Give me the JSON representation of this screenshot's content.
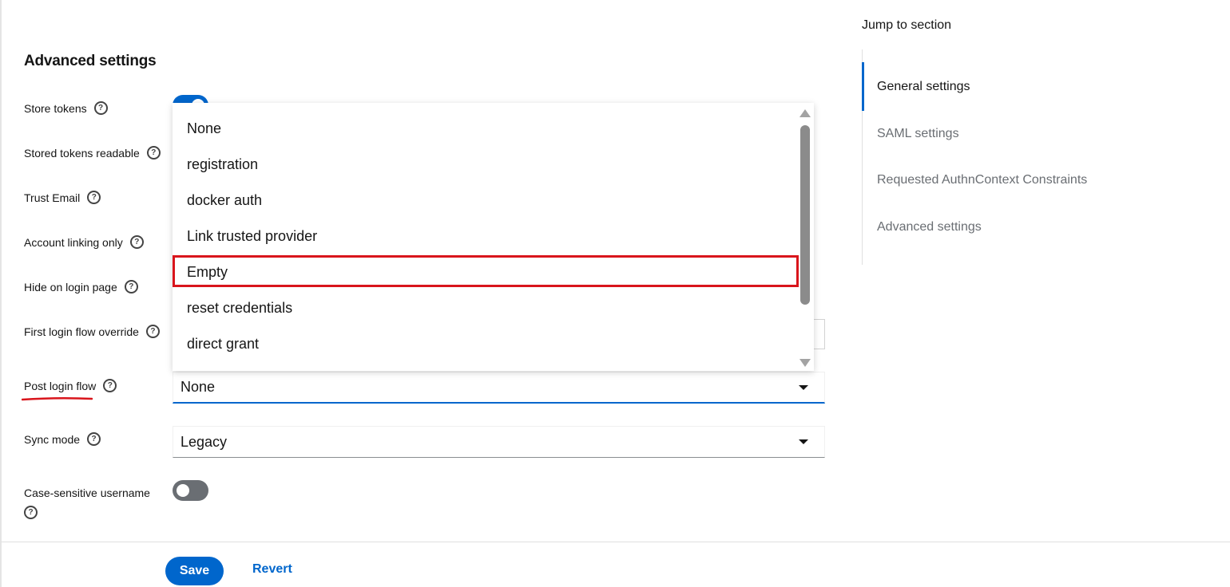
{
  "section_title": "Advanced settings",
  "fields": {
    "store_tokens": "Store tokens",
    "stored_tokens_readable": "Stored tokens readable",
    "trust_email": "Trust Email",
    "account_linking_only": "Account linking only",
    "hide_on_login_page": "Hide on login page",
    "first_login_flow_override": "First login flow override",
    "post_login_flow": "Post login flow",
    "sync_mode": "Sync mode",
    "case_sensitive_username": "Case-sensitive username"
  },
  "values": {
    "post_login_flow": "None",
    "sync_mode": "Legacy",
    "store_tokens_on": true,
    "case_sensitive_username_on": false
  },
  "dropdown": {
    "options": [
      "None",
      "registration",
      "docker auth",
      "Link trusted provider",
      "Empty",
      "reset credentials",
      "direct grant"
    ],
    "highlighted": "Empty"
  },
  "jump_to_section": {
    "title": "Jump to section",
    "items": [
      "General settings",
      "SAML settings",
      "Requested AuthnContext Constraints",
      "Advanced settings"
    ],
    "active": "General settings"
  },
  "footer": {
    "save": "Save",
    "revert": "Revert"
  },
  "icons": {
    "help": "?"
  },
  "colors": {
    "primary": "#0066cc",
    "annotation": "#d9151c"
  }
}
